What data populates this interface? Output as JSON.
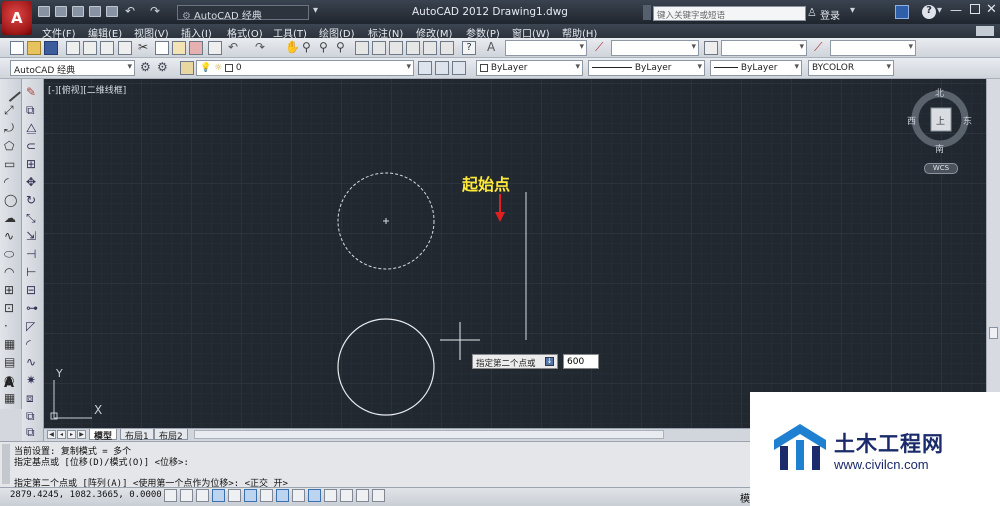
{
  "app": {
    "logo": "A",
    "title": "AutoCAD 2012    Drawing1.dwg",
    "workspace": "AutoCAD 经典",
    "search_placeholder": "键入关键字或短语",
    "login": "登录"
  },
  "menu": [
    "文件(F)",
    "编辑(E)",
    "视图(V)",
    "插入(I)",
    "格式(O)",
    "工具(T)",
    "绘图(D)",
    "标注(N)",
    "修改(M)",
    "参数(P)",
    "窗口(W)",
    "帮助(H)"
  ],
  "toolbar2": {
    "workspace": "AutoCAD 经典",
    "layer": "0",
    "color": "ByLayer",
    "linetype": "ByLayer",
    "lineweight": "ByLayer",
    "plotstyle": "BYCOLOR"
  },
  "viewport": {
    "label": "[-][俯视][二维线框]",
    "annotation": "起始点",
    "axis_x": "X",
    "axis_y": "Y"
  },
  "viewcube": {
    "north": "北",
    "south": "南",
    "east": "东",
    "west": "西",
    "face": "上",
    "wcs": "WCS"
  },
  "dynamic_input": {
    "prompt": "指定第二个点或",
    "value": "600"
  },
  "tabs": [
    "模型",
    "布局1",
    "布局2"
  ],
  "command_lines": [
    "当前设置:  复制模式 = 多个",
    "指定基点或 [位移(D)/模式(O)] <位移>:",
    "",
    "指定第二个点或 [阵列(A)] <使用第一个点作为位移>:  <正交 开>"
  ],
  "status": {
    "coords": "2879.4245, 1082.3665, 0.0000",
    "model": "模"
  },
  "watermark": {
    "name": "土木工程网",
    "url": "www.civilcn.com"
  },
  "colors": {
    "canvas": "#212830",
    "annotation": "#ffe93a",
    "arrow": "#e02020",
    "watermark": "#1a2a6a"
  }
}
